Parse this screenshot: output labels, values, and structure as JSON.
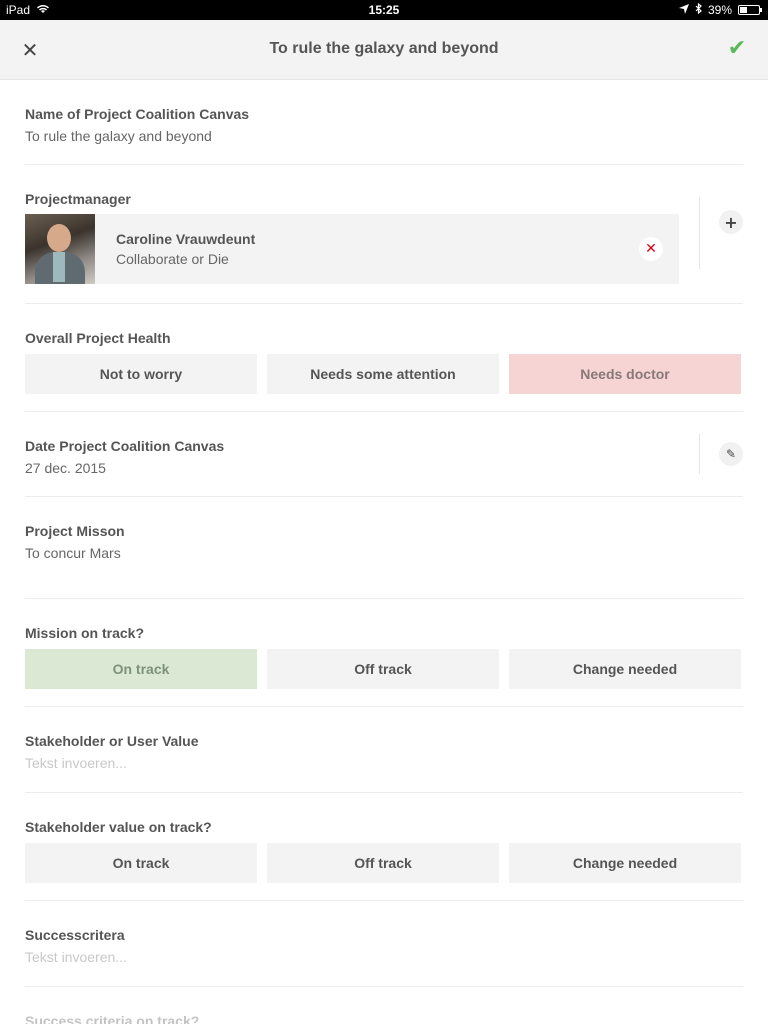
{
  "status_bar": {
    "device": "iPad",
    "time": "15:25",
    "battery": "39%",
    "battery_level": 0.39,
    "icons": [
      "wifi-icon",
      "location-arrow-icon",
      "bluetooth-icon",
      "battery-icon"
    ]
  },
  "navbar": {
    "title": "To rule the galaxy and beyond",
    "close_icon": "close-icon",
    "done_icon": "checkmark-icon",
    "close_glyph": "✕",
    "done_glyph": "✔",
    "done_color": "#5cb85c"
  },
  "sections": {
    "name": {
      "label": "Name of Project Coalition Canvas",
      "value": "To rule the galaxy and beyond"
    },
    "manager": {
      "label": "Projectmanager",
      "name": "Caroline Vrauwdeunt",
      "role": "Collaborate or Die",
      "remove_glyph": "✕",
      "add_glyph": "+"
    },
    "health": {
      "label": "Overall Project Health",
      "options": [
        "Not to worry",
        "Needs some attention",
        "Needs doctor"
      ],
      "selected": "Needs doctor",
      "selected_color": "#f6d4d4"
    },
    "date": {
      "label": "Date Project Coalition Canvas",
      "value": "27 dec. 2015",
      "edit_glyph": "✎"
    },
    "mission": {
      "label": "Project Misson",
      "value": "To concur Mars"
    },
    "mission_track": {
      "label": "Mission on track?",
      "options": [
        "On track",
        "Off track",
        "Change needed"
      ],
      "selected": "On track",
      "selected_color": "#dbe8d4"
    },
    "stakeholder": {
      "label": "Stakeholder or User Value",
      "placeholder": "Tekst invoeren..."
    },
    "stakeholder_track": {
      "label": "Stakeholder value on track?",
      "options": [
        "On track",
        "Off track",
        "Change needed"
      ]
    },
    "success": {
      "label": "Successcritera",
      "placeholder": "Tekst invoeren..."
    },
    "success_track": {
      "label": "Success criteria on track?"
    }
  }
}
